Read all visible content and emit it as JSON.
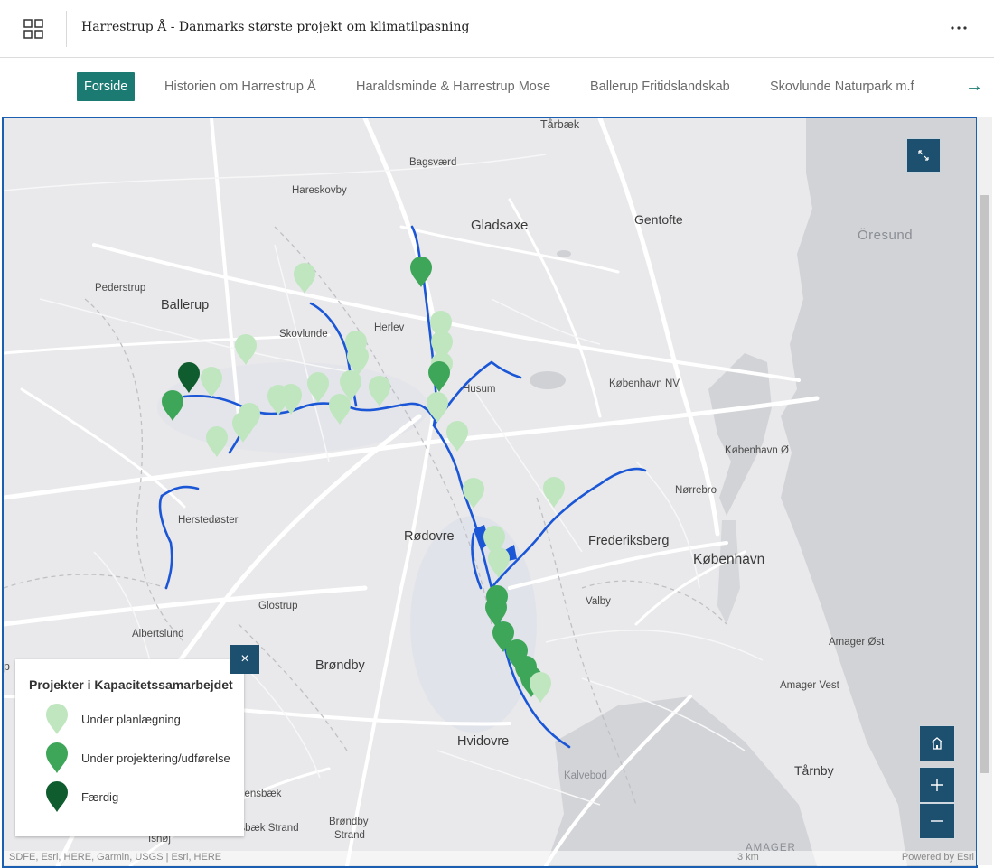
{
  "header": {
    "title": "Harrestrup Å - Danmarks største projekt om klimatilpasning",
    "grid_icon": "grid-icon",
    "more_icon": "more-horizontal-icon"
  },
  "nav": {
    "tabs": [
      {
        "label": "Forside",
        "active": true
      },
      {
        "label": "Historien om Harrestrup Å",
        "active": false
      },
      {
        "label": "Haraldsminde & Harrestrup Mose",
        "active": false
      },
      {
        "label": "Ballerup Fritidslandskab",
        "active": false
      },
      {
        "label": "Skovlunde Naturpark m.f",
        "active": false
      }
    ],
    "arrow": "→"
  },
  "map": {
    "places": {
      "tarbaek": "Tårbæk",
      "bagsvaerd": "Bagsværd",
      "hareskovby": "Hareskovby",
      "gladsaxe": "Gladsaxe",
      "gentofte": "Gentofte",
      "oresund": "Öresund",
      "pederstrup": "Pederstrup",
      "ballerup": "Ballerup",
      "skovlunde": "Skovlunde",
      "herlev": "Herlev",
      "husum": "Husum",
      "kbh_nv": "København NV",
      "kbh_o": "København Ø",
      "norrebro": "Nørrebro",
      "herstedoster": "Herstedøster",
      "rodovre": "Rødovre",
      "frederiksberg": "Frederiksberg",
      "kobenhavn": "København",
      "valby": "Valby",
      "glostrup": "Glostrup",
      "albertslund": "Albertslund",
      "amager_ost": "Amager Øst",
      "brondby": "Brøndby",
      "amager_vest": "Amager Vest",
      "hvidovre": "Hvidovre",
      "tarnby": "Tårnby",
      "kalvebod": "Kalvebod",
      "vallensbaek": "allensbæk",
      "vallensbaek_strand": "nsbæk Strand",
      "brondby_strand_1": "Brøndby",
      "brondby_strand_2": "Strand",
      "ishoj": "Ishøj",
      "amager_bottom": "AMAGER",
      "edge_p": "p"
    },
    "attribution_left": "SDFE, Esri, HERE, Garmin, USGS | Esri, HERE",
    "scale_text": "3 km",
    "powered_by": "Powered by Esri",
    "expand_icon": "expand-icon",
    "home_icon": "home-icon",
    "zoom_in_icon": "plus-icon",
    "zoom_out_icon": "minus-icon",
    "colors": {
      "planning": "#bfe6bf",
      "in_progress": "#3ea659",
      "done": "#0f5c2e",
      "stream": "#1a56d6",
      "control": "#1d4f6e"
    }
  },
  "legend": {
    "title": "Projekter i Kapacitetssamarbejdet",
    "close_icon": "close-icon",
    "close_glyph": "×",
    "items": [
      {
        "label": "Under planlægning",
        "status": "planning"
      },
      {
        "label": "Under projektering/udførelse",
        "status": "in_progress"
      },
      {
        "label": "Færdig",
        "status": "done"
      }
    ]
  }
}
